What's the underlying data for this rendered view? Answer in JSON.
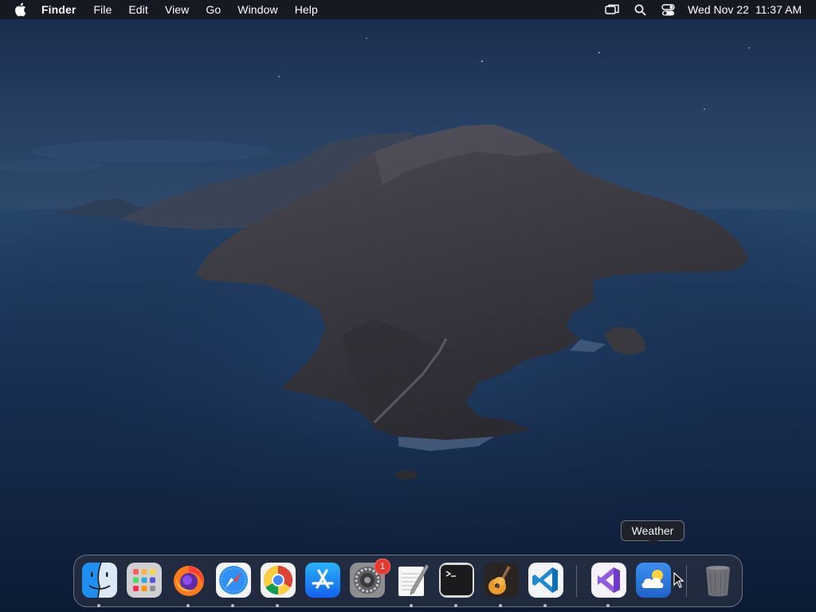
{
  "menubar": {
    "app_name": "Finder",
    "menus": [
      "File",
      "Edit",
      "View",
      "Go",
      "Window",
      "Help"
    ],
    "status_icons": [
      "screen-mirroring-icon",
      "spotlight-search-icon",
      "control-center-icon"
    ],
    "date": "Wed Nov 22",
    "time": "11:37 AM"
  },
  "tooltip": {
    "text": "Weather"
  },
  "dock": {
    "apps": [
      {
        "name": "Finder",
        "icon": "finder-icon",
        "running": true
      },
      {
        "name": "Launchpad",
        "icon": "launchpad-icon",
        "running": false
      },
      {
        "name": "Firefox",
        "icon": "firefox-icon",
        "running": true
      },
      {
        "name": "Safari",
        "icon": "safari-icon",
        "running": true
      },
      {
        "name": "Google Chrome",
        "icon": "chrome-icon",
        "running": true
      },
      {
        "name": "App Store",
        "icon": "app-store-icon",
        "running": false
      },
      {
        "name": "System Preferences",
        "icon": "system-preferences-icon",
        "running": false,
        "badge": "1"
      },
      {
        "name": "TextEdit",
        "icon": "textedit-icon",
        "running": true
      },
      {
        "name": "Terminal",
        "icon": "terminal-icon",
        "running": true
      },
      {
        "name": "GarageBand",
        "icon": "garageband-icon",
        "running": true
      },
      {
        "name": "Visual Studio Code",
        "icon": "vscode-icon",
        "running": true
      },
      {
        "name": "Visual Studio",
        "icon": "visual-studio-icon",
        "running": true
      },
      {
        "name": "Weather",
        "icon": "weather-icon",
        "running": false
      },
      {
        "name": "Trash",
        "icon": "trash-icon",
        "running": false
      }
    ]
  },
  "colors": {
    "menubar_bg": "#16181e",
    "badge_red": "#e8382f",
    "sky": "#1f3558",
    "sea": "#13274a"
  }
}
